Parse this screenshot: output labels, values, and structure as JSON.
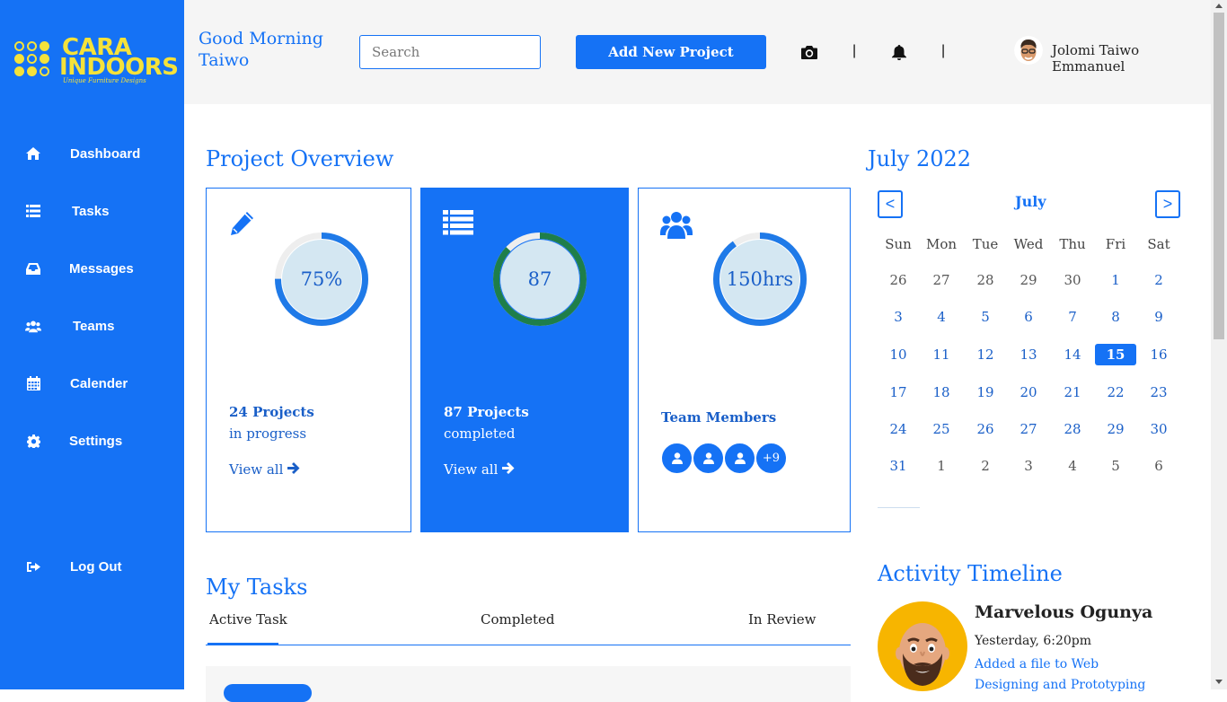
{
  "brand": {
    "line1": "CARA",
    "line2": "INDOORS",
    "tagline": "Unique Furniture Designs",
    "logo_color": "#f5e23a"
  },
  "colors": {
    "primary": "#1572f5",
    "sidebar": "#1572f5",
    "success": "#1e7e4a"
  },
  "sidebar": {
    "items": [
      {
        "label": "Dashboard",
        "icon": "home-icon"
      },
      {
        "label": "Tasks",
        "icon": "list-icon"
      },
      {
        "label": "Messages",
        "icon": "inbox-icon"
      },
      {
        "label": "Teams",
        "icon": "users-icon"
      },
      {
        "label": "Calender",
        "icon": "calendar-icon"
      },
      {
        "label": "Settings",
        "icon": "gear-icon"
      }
    ],
    "logout": {
      "label": "Log Out",
      "icon": "sign-out-icon"
    }
  },
  "header": {
    "greeting_line1": "Good Morning",
    "greeting_line2": "Taiwo",
    "search_placeholder": "Search",
    "add_project_label": "Add New Project",
    "separator": "|",
    "user_name": "Jolomi Taiwo Emmanuel"
  },
  "overview": {
    "title": "Project Overview",
    "cards": [
      {
        "icon": "pencil-icon",
        "value_label": "75%",
        "progress": 0.75,
        "line1": "24 Projects",
        "line2": "in progress",
        "link": "View all"
      },
      {
        "icon": "list-icon",
        "value_label": "87",
        "progress": 0.87,
        "line1": "87 Projects",
        "line2": "completed",
        "link": "View all"
      },
      {
        "icon": "users-icon",
        "value_label": "150hrs",
        "progress": 0.9,
        "line1": "Team Members",
        "extra_members": "+9"
      }
    ]
  },
  "calendar": {
    "title": "July 2022",
    "month": "July",
    "prev": "<",
    "next": ">",
    "weekdays": [
      "Sun",
      "Mon",
      "Tue",
      "Wed",
      "Thu",
      "Fri",
      "Sat"
    ],
    "weeks": [
      [
        "26",
        "27",
        "28",
        "29",
        "30",
        "1",
        "2"
      ],
      [
        "3",
        "4",
        "5",
        "6",
        "7",
        "8",
        "9"
      ],
      [
        "10",
        "11",
        "12",
        "13",
        "14",
        "15",
        "16"
      ],
      [
        "17",
        "18",
        "19",
        "20",
        "21",
        "22",
        "23"
      ],
      [
        "24",
        "25",
        "26",
        "27",
        "28",
        "29",
        "30"
      ],
      [
        "31",
        "1",
        "2",
        "3",
        "4",
        "5",
        "6"
      ]
    ],
    "selected_day": "15"
  },
  "tasks": {
    "title": "My Tasks",
    "tabs": [
      "Active Task",
      "Completed",
      "In Review"
    ]
  },
  "activity": {
    "title": "Activity Timeline",
    "name": "Marvelous Ogunya",
    "time": "Yesterday, 6:20pm",
    "description": "Added a file to Web Designing and Prototyping"
  }
}
